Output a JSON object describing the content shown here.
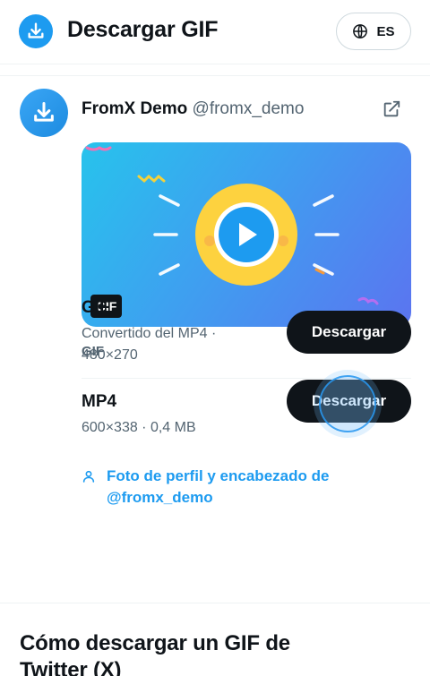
{
  "header": {
    "title": "Descargar GIF",
    "lang_label": "ES",
    "accent_color": "#1d9bf0"
  },
  "post": {
    "author_name": "FromX Demo",
    "author_handle": "@fromx_demo",
    "media_badge": "GIF",
    "section_label": "GIF"
  },
  "downloads": [
    {
      "title": "GIF",
      "meta": "Convertido del MP4 · 480×270",
      "button": "Descargar"
    },
    {
      "title": "MP4",
      "meta": "600×338 · 0,4 MB",
      "button": "Descargar"
    }
  ],
  "profile_link": {
    "label": "Foto de perfil y encabezado de @fromx_demo"
  },
  "howto": {
    "heading": "Cómo descargar un GIF de Twitter (X)"
  },
  "icons": [
    "download-icon",
    "globe-icon",
    "external-link-icon",
    "play-icon",
    "user-icon"
  ]
}
